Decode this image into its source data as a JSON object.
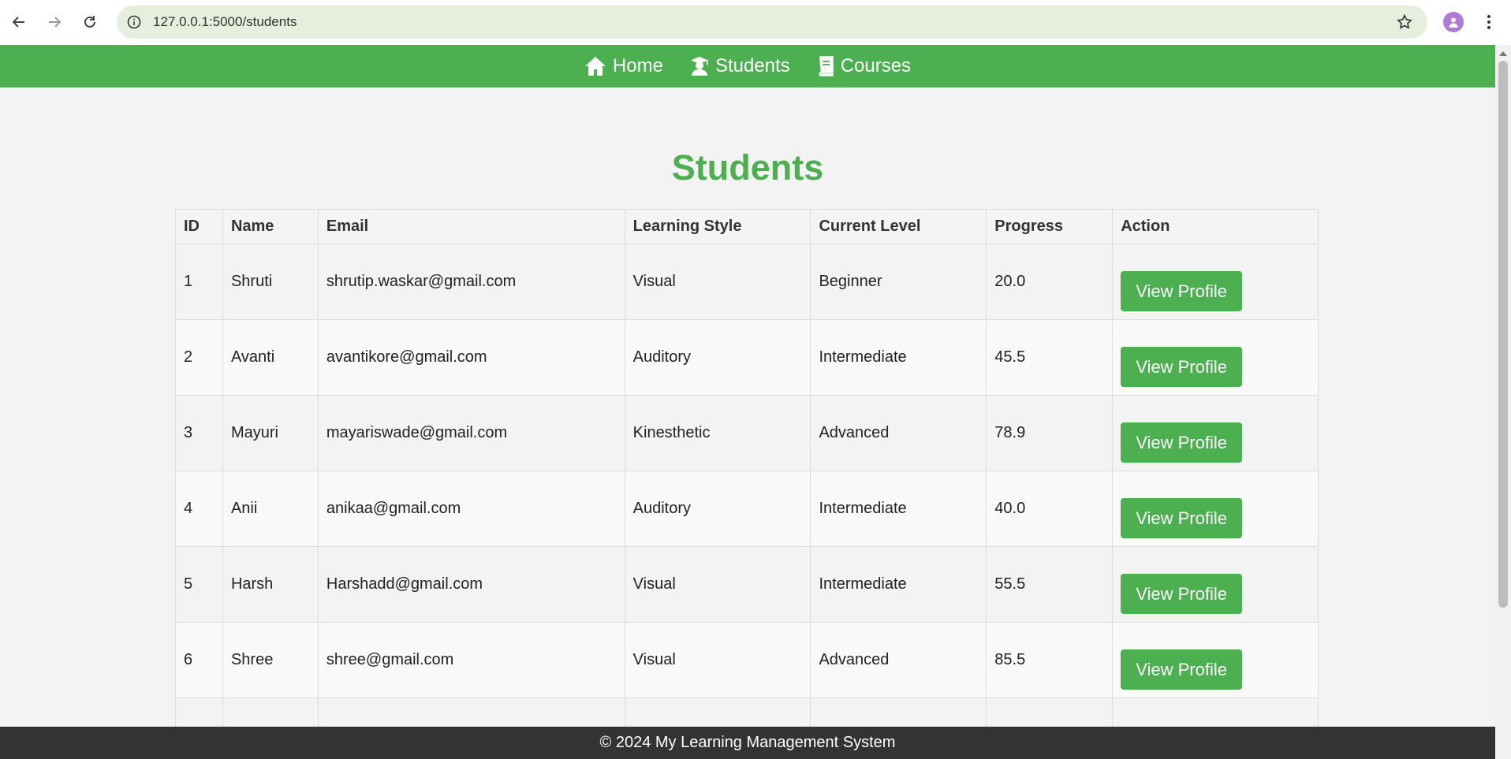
{
  "browser": {
    "url": "127.0.0.1:5000/students",
    "icons": [
      "back-icon",
      "forward-icon",
      "reload-icon",
      "info-icon",
      "star-icon",
      "avatar",
      "more-icon"
    ]
  },
  "nav": {
    "items": [
      {
        "label": "Home",
        "icon": "home-icon"
      },
      {
        "label": "Students",
        "icon": "student-icon"
      },
      {
        "label": "Courses",
        "icon": "book-icon"
      }
    ]
  },
  "colors": {
    "accent": "#4caf50",
    "footer": "#333333"
  },
  "page": {
    "title": "Students"
  },
  "table": {
    "headers": [
      "ID",
      "Name",
      "Email",
      "Learning Style",
      "Current Level",
      "Progress",
      "Action"
    ],
    "button_label": "View Profile",
    "rows": [
      {
        "id": "1",
        "name": "Shruti",
        "email": "shrutip.waskar@gmail.com",
        "style": "Visual",
        "level": "Beginner",
        "progress": "20.0"
      },
      {
        "id": "2",
        "name": "Avanti",
        "email": "avantikore@gmail.com",
        "style": "Auditory",
        "level": "Intermediate",
        "progress": "45.5"
      },
      {
        "id": "3",
        "name": "Mayuri",
        "email": "mayariswade@gmail.com",
        "style": "Kinesthetic",
        "level": "Advanced",
        "progress": "78.9"
      },
      {
        "id": "4",
        "name": "Anii",
        "email": "anikaa@gmail.com",
        "style": "Auditory",
        "level": "Intermediate",
        "progress": "40.0"
      },
      {
        "id": "5",
        "name": "Harsh",
        "email": "Harshadd@gmail.com",
        "style": "Visual",
        "level": "Intermediate",
        "progress": "55.5"
      },
      {
        "id": "6",
        "name": "Shree",
        "email": "shree@gmail.com",
        "style": "Visual",
        "level": "Advanced",
        "progress": "85.5"
      }
    ]
  },
  "footer": {
    "text": "© 2024 My Learning Management System"
  }
}
